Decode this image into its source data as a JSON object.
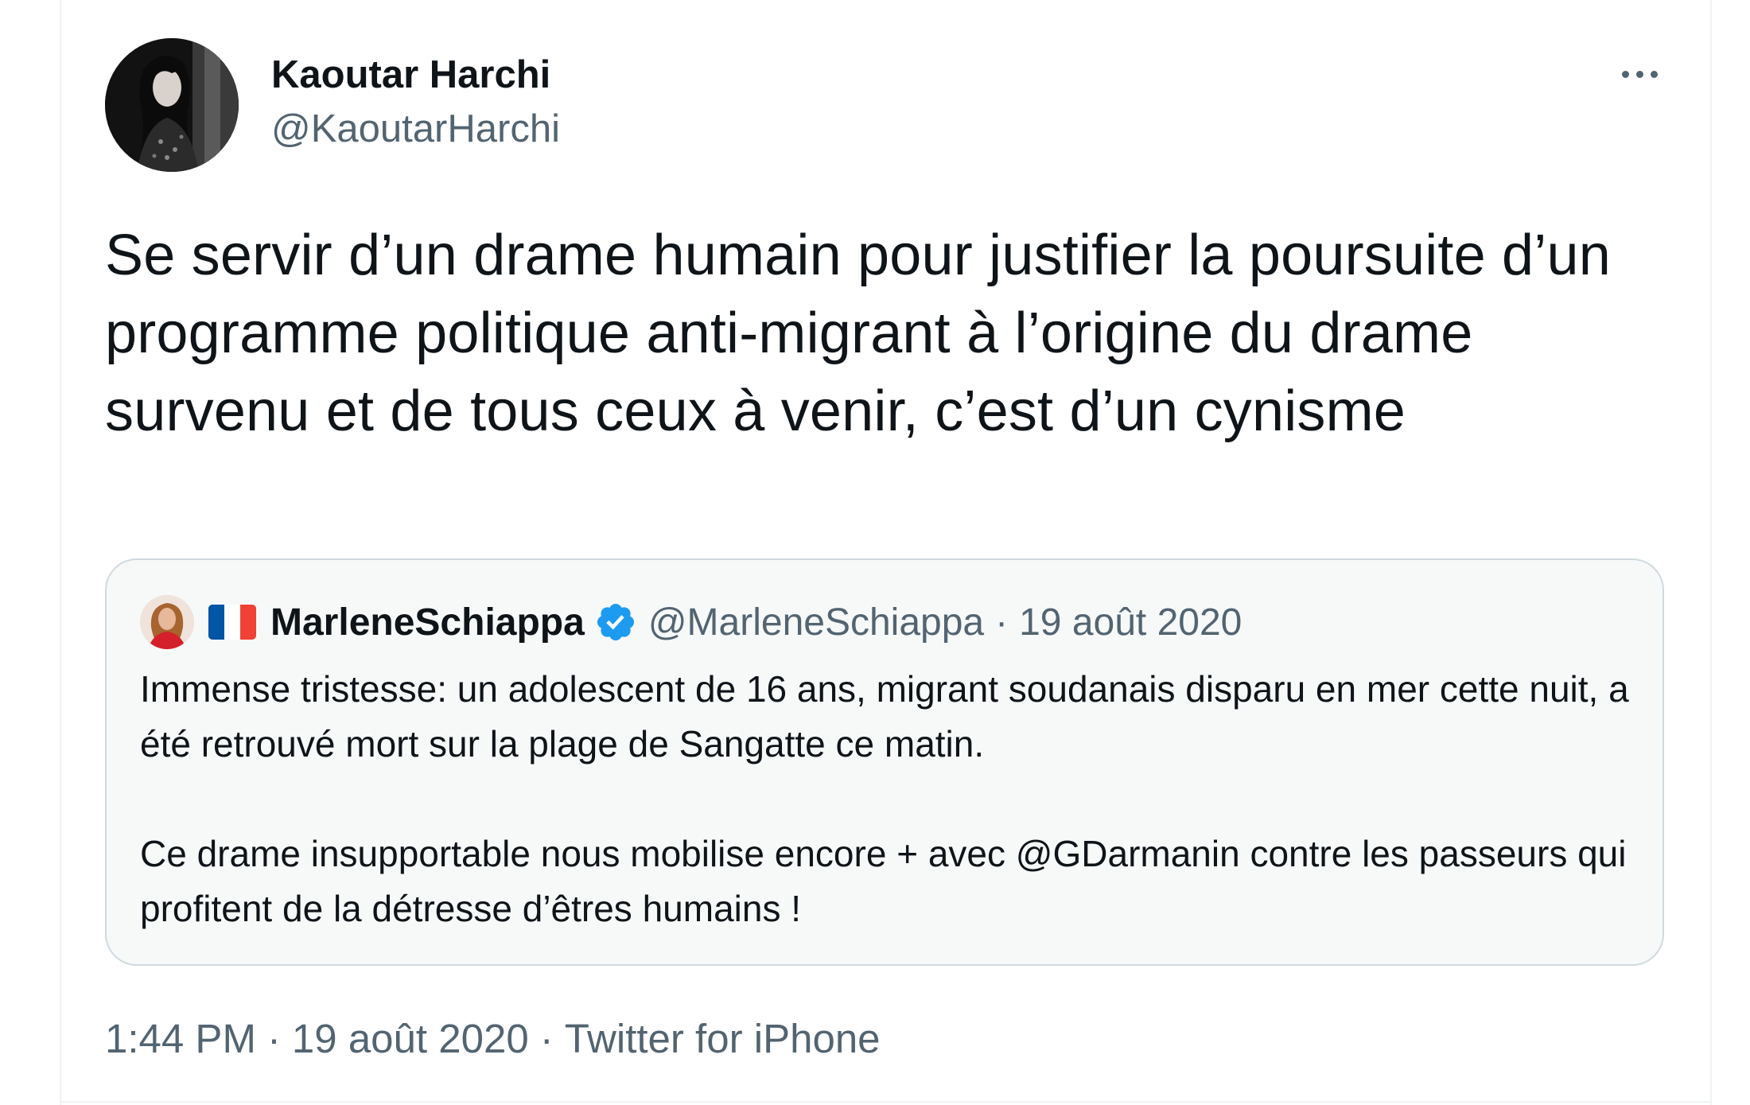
{
  "tweet": {
    "author_name": "Kaoutar Harchi",
    "author_handle": "@KaoutarHarchi",
    "avatar_icon": "user-avatar-photo",
    "more_icon": "more-horizontal-icon",
    "text": "Se servir d’un drame humain pour justifier la poursuite d’un programme politique anti-migrant à l’origine du drame survenu et de tous ceux à venir, c’est d’un cynisme",
    "time": "1:44 PM",
    "separator": "·",
    "date": "19 août 2020",
    "source": "Twitter for iPhone"
  },
  "quoted_tweet": {
    "avatar_icon": "user-avatar-photo",
    "flag_icon": "france-flag-icon",
    "flag_colors": [
      "#0055a4",
      "#ffffff",
      "#ef4135"
    ],
    "author_name": "MarleneSchiappa",
    "verified_icon": "verified-badge-icon",
    "verified_color": "#1d9bf0",
    "author_handle": "@MarleneSchiappa",
    "separator": "·",
    "date": "19 août 2020",
    "text": "Immense tristesse: un adolescent de 16 ans, migrant soudanais disparu en mer cette nuit, a été retrouvé mort sur la plage de Sangatte ce matin.\n\nCe drame insupportable nous mobilise encore + avec @GDarmanin contre les passeurs qui profitent de la détresse d’êtres humains !"
  },
  "colors": {
    "text_primary": "#0f1419",
    "text_secondary": "#536471",
    "card_border": "#cfd9de",
    "card_background": "#f7f9f9"
  }
}
